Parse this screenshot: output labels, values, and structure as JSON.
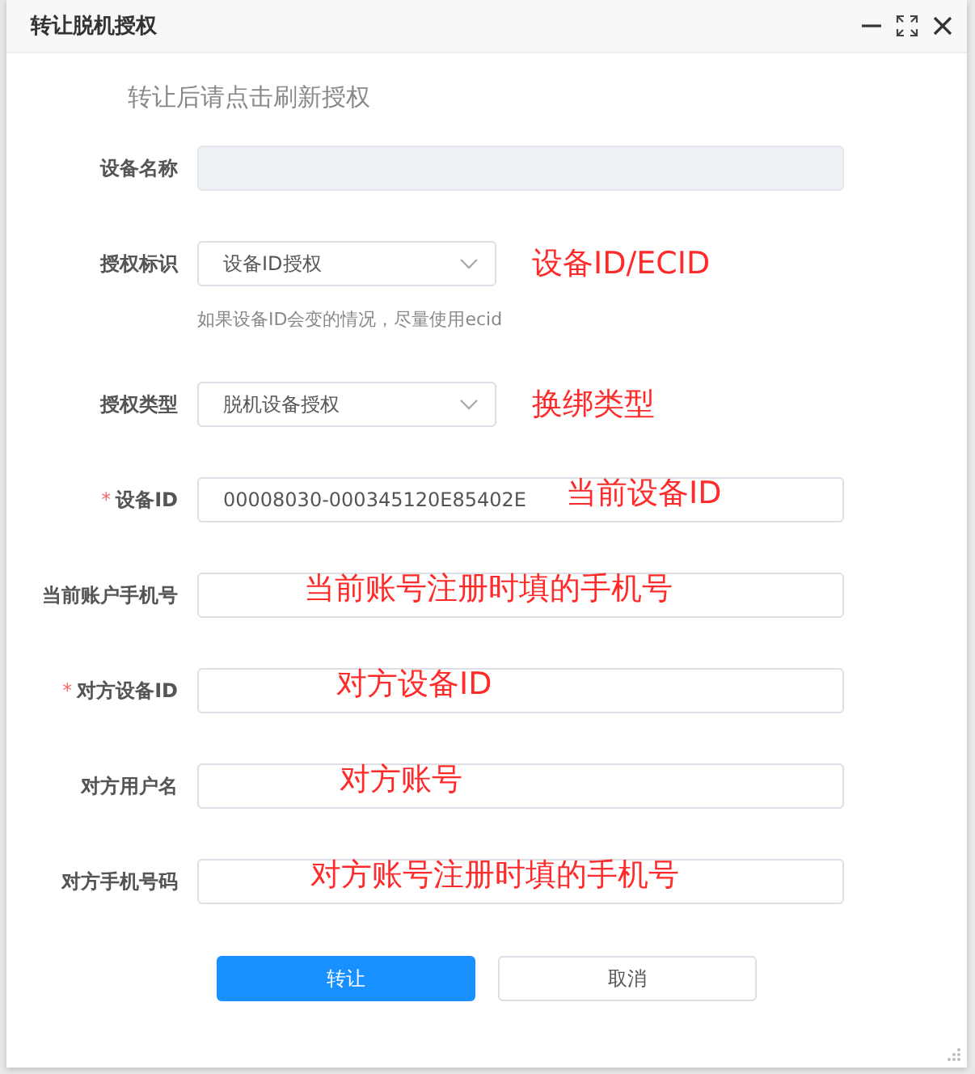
{
  "window": {
    "title": "转让脱机授权"
  },
  "notice": "转让后请点击刷新授权",
  "fields": [
    {
      "kind": "text",
      "label": "设备名称",
      "disabled": true
    },
    {
      "kind": "select",
      "label": "授权标识",
      "value": "设备ID授权",
      "hint": "如果设备ID会变的情况，尽量使用ecid",
      "annotation": "设备ID/ECID"
    },
    {
      "kind": "select",
      "label": "授权类型",
      "value": "脱机设备授权",
      "annotation": "换绑类型"
    },
    {
      "kind": "text",
      "label": "设备ID",
      "required_mark": "*",
      "value": "00008030-000345120E85402E",
      "annotation": "当前设备ID"
    },
    {
      "kind": "text",
      "label": "当前账户手机号",
      "annotation": "当前账号注册时填的手机号"
    },
    {
      "kind": "text",
      "label": "对方设备ID",
      "required_mark": "*",
      "annotation": "对方设备ID"
    },
    {
      "kind": "text",
      "label": "对方用户名",
      "annotation": "对方账号"
    },
    {
      "kind": "text",
      "label": "对方手机号码",
      "annotation": "对方账号注册时填的手机号"
    }
  ],
  "buttons": [
    {
      "label": "转让",
      "kind": "primary"
    },
    {
      "label": "取消",
      "kind": "default"
    }
  ]
}
